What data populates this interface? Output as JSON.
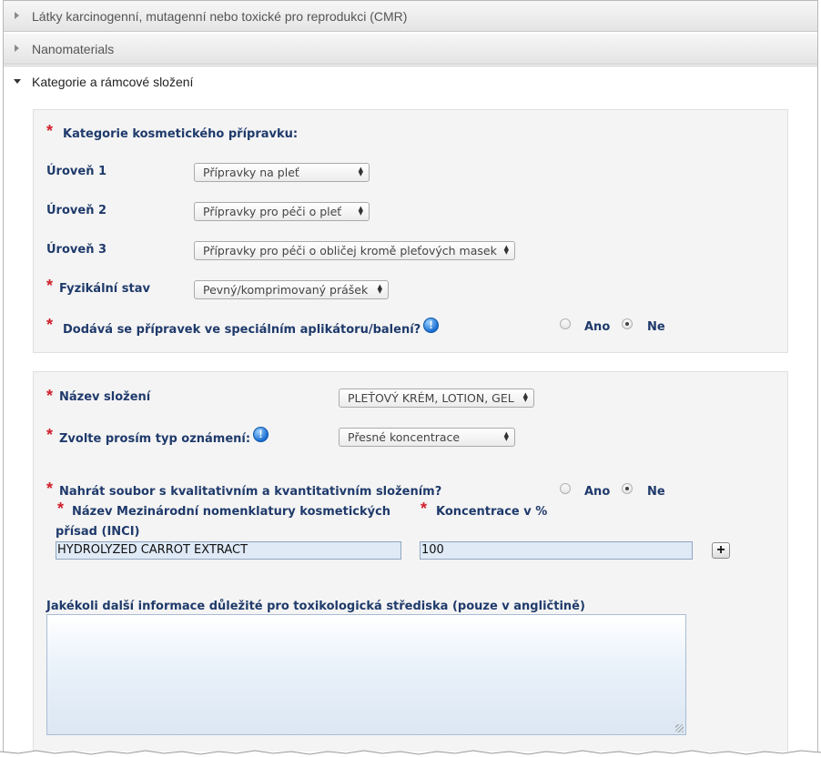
{
  "accordion": {
    "cmr_title": "Látky karcinogenní, mutagenní nebo toxické pro reprodukci (CMR)",
    "nano_title": "Nanomaterials",
    "category_title": "Kategorie a rámcové složení"
  },
  "category_panel": {
    "heading": "Kategorie kosmetického přípravku:",
    "level1_label": "Úroveň 1",
    "level1_value": "Přípravky na pleť",
    "level2_label": "Úroveň 2",
    "level2_value": "Přípravky pro péči o pleť",
    "level3_label": "Úroveň 3",
    "level3_value": "Přípravky pro péči o obličej kromě pleťových masek",
    "physical_label": "Fyzikální stav",
    "physical_value": "Pevný/komprimovaný prášek",
    "applicator_question": "Dodává se přípravek ve speciálním aplikátoru/balení?",
    "yes": "Ano",
    "no": "Ne",
    "applicator_selected": "Ne"
  },
  "formulation_panel": {
    "name_label": "Název složení",
    "name_value": "PLEŤOVÝ KRÉM, LOTION, GEL",
    "type_label": "Zvolte prosím typ oznámení:",
    "type_value": "Přesné koncentrace",
    "upload_question": "Nahrát soubor s kvalitativním a kvantitativním složením?",
    "yes": "Ano",
    "no": "Ne",
    "upload_selected": "Ne",
    "inci_label_line1": "Název Mezinárodní nomenklatury kosmetických",
    "inci_label_line2": "přísad (INCI)",
    "concentration_label": "Koncentrace v %",
    "inci_value": "HYDROLYZED CARROT EXTRACT",
    "concentration_value": "100",
    "add_button": "+",
    "extra_info_label": "Jakékoli další informace důležité pro toxikologická střediska (pouze v angličtině)",
    "extra_info_value": ""
  }
}
